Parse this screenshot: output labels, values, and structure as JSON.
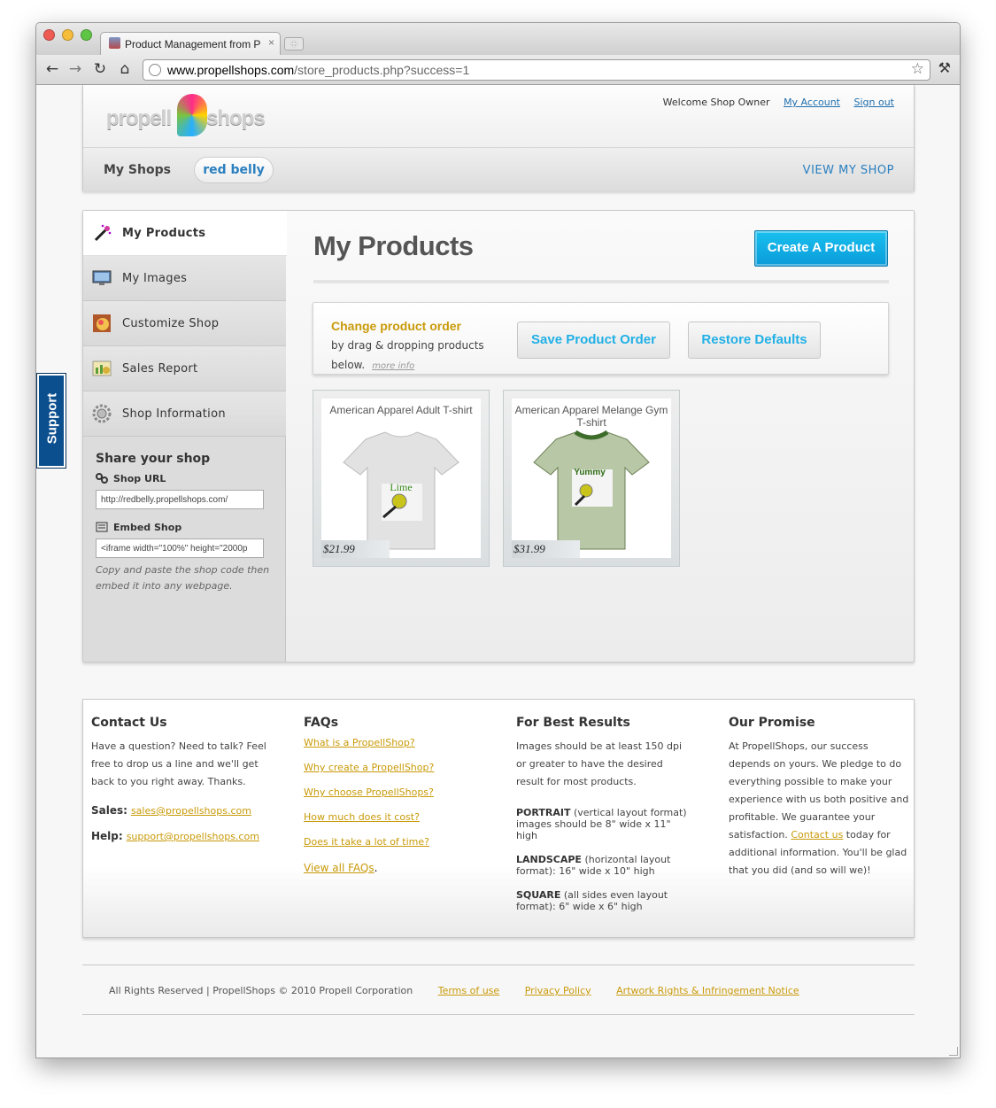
{
  "browser": {
    "tab_title": "Product Management from P",
    "tab_close": "×",
    "new_tab": "+",
    "url_host": "www.propellshops.com",
    "url_path": "/store_products.php?success=1"
  },
  "header": {
    "logo_left": "propell",
    "logo_right": "shops",
    "welcome": "Welcome Shop Owner",
    "my_account": "My Account",
    "sign_out": "Sign out",
    "my_shops": "My Shops",
    "shop_name": "red belly",
    "view_shop": "VIEW MY SHOP"
  },
  "sidebar": {
    "items": [
      {
        "label": "My Products"
      },
      {
        "label": "My Images"
      },
      {
        "label": "Customize Shop"
      },
      {
        "label": "Sales Report"
      },
      {
        "label": "Shop Information"
      }
    ],
    "share_title": "Share your shop",
    "shop_url_label": "Shop URL",
    "shop_url_value": "http://redbelly.propellshops.com/",
    "embed_label": "Embed Shop",
    "embed_value": "<iframe width=\"100%\" height=\"2000p",
    "note": "Copy and paste the shop code then embed it into any webpage."
  },
  "main": {
    "title": "My Products",
    "create_button": "Create A Product",
    "order_title": "Change product order",
    "order_text": "by drag & dropping products below.",
    "more_info": "more info",
    "save_order": "Save Product Order",
    "restore_defaults": "Restore Defaults",
    "products": [
      {
        "name": "American Apparel Adult T-shirt",
        "price": "$21.99",
        "shirt_text": "Lime",
        "shirt_color": "#e2e2e2"
      },
      {
        "name": "American Apparel Melange Gym T-shirt",
        "price": "$31.99",
        "shirt_text": "Yummy",
        "shirt_color": "#b8c8a6"
      }
    ]
  },
  "footer": {
    "contact": {
      "title": "Contact Us",
      "text": "Have a question? Need to talk? Feel free to drop us a line and we'll get back to you right away. Thanks.",
      "sales_label": "Sales:",
      "sales_email": "sales@propellshops.com",
      "help_label": "Help:",
      "help_email": "support@propellshops.com"
    },
    "faqs": {
      "title": "FAQs",
      "links": [
        "What is a PropellShop?",
        "Why create a PropellShop?",
        "Why choose PropellShops?",
        "How much does it cost?",
        "Does it take a lot of time?"
      ],
      "view_all": "View all FAQs",
      "view_all_suffix": "."
    },
    "results": {
      "title": "For Best Results",
      "intro": "Images should be at least 150 dpi or greater to have the desired result for most products.",
      "portrait_label": "PORTRAIT",
      "portrait_text": " (vertical layout format) images should be 8\" wide x 11\" high",
      "landscape_label": "LANDSCAPE",
      "landscape_text": " (horizontal layout format): 16\" wide x 10\" high",
      "square_label": "SQUARE",
      "square_text": " (all sides even layout format): 6\" wide x 6\" high"
    },
    "promise": {
      "title": "Our Promise",
      "text": "At PropellShops, our success depends on yours. We pledge to do everything possible to make your experience with us both positive and profitable. We guarantee your satisfaction.",
      "contact_link": "Contact us",
      "text_after": " today for additional information. You'll be glad that you did (and so will we)!"
    }
  },
  "copyright": {
    "text": "All Rights Reserved | PropellShops © 2010 Propell Corporation",
    "terms": "Terms of use",
    "privacy": "Privacy Policy",
    "artwork": "Artwork Rights & Infringement Notice"
  },
  "support_tab": "Support"
}
